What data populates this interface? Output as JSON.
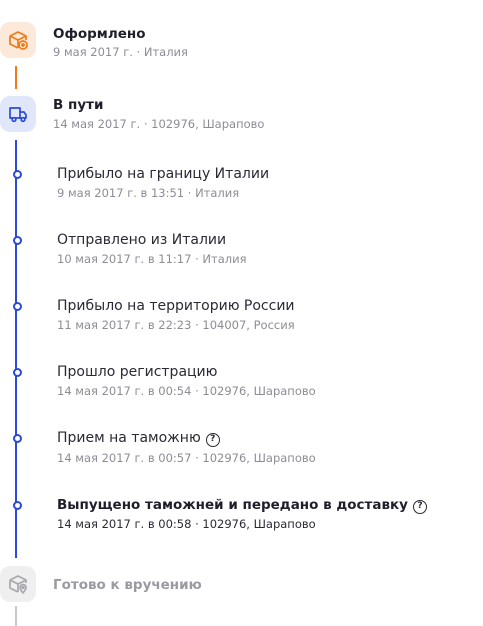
{
  "colors": {
    "accent_orange": "#f07a1a",
    "accent_blue": "#2b4bd6",
    "muted_gray": "#a8a8b0"
  },
  "stages": [
    {
      "title": "Оформлено",
      "meta": "9 мая 2017 г. · Италия",
      "icon": "box-plus-icon",
      "state": "done"
    },
    {
      "title": "В пути",
      "meta": "14 мая 2017 г. · 102976, Шарапово",
      "icon": "truck-icon",
      "state": "active"
    },
    {
      "title": "Готово к вручению",
      "meta": "",
      "icon": "box-pin-icon",
      "state": "pending"
    }
  ],
  "events": [
    {
      "title": "Прибыло на границу Италии",
      "meta": "9 мая 2017 г. в 13:51 · Италия"
    },
    {
      "title": "Отправлено из Италии",
      "meta": "10 мая 2017 г. в 11:17 · Италия"
    },
    {
      "title": "Прибыло на территорию России",
      "meta": "11 мая 2017 г. в 22:23 · 104007, Россия"
    },
    {
      "title": "Прошло регистрацию",
      "meta": "14 мая 2017 г. в 00:54 · 102976, Шарапово"
    },
    {
      "title": "Прием на таможню",
      "meta": "14 мая 2017 г. в 00:57 · 102976, Шарапово",
      "help": "?"
    },
    {
      "title": "Выпущено таможней и передано в доставку",
      "meta": "14 мая 2017 г. в 00:58 · 102976, Шарапово",
      "help": "?"
    }
  ]
}
